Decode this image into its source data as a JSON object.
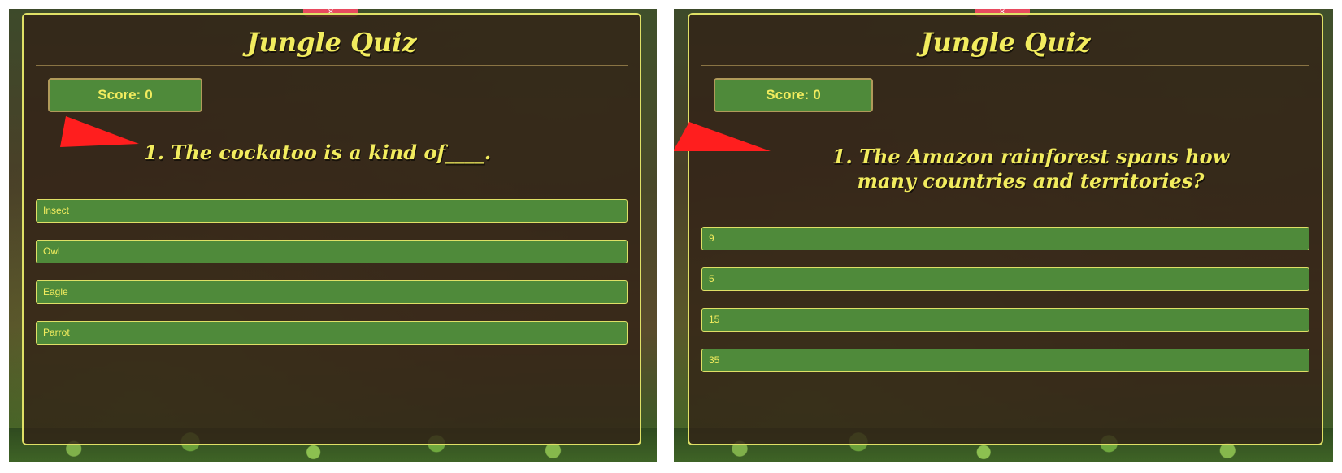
{
  "panels": [
    {
      "close_tab": "×",
      "title": "Jungle Quiz",
      "score": {
        "label": "Score:",
        "value": "0"
      },
      "question": "1. The cockatoo is a kind of____.",
      "answers": [
        "Insect",
        "Owl",
        "Eagle",
        "Parrot"
      ]
    },
    {
      "close_tab": "×",
      "title": "Jungle Quiz",
      "score": {
        "label": "Score:",
        "value": "0"
      },
      "question": "1. The Amazon rainforest spans how many countries and territories?",
      "answers": [
        "9",
        "5",
        "15",
        "35"
      ]
    }
  ],
  "colors": {
    "title_text": "#f2ec5e",
    "panel_border": "#dfe066",
    "panel_bg": "rgba(50,34,22,0.80)",
    "button_green": "#4f8a3a",
    "pointer_red": "#ff1e1e",
    "tab_red": "#e84a5f"
  },
  "icons": {
    "pointer": "red-triangle-pointer-icon",
    "close_tab": "close-tab-icon"
  }
}
